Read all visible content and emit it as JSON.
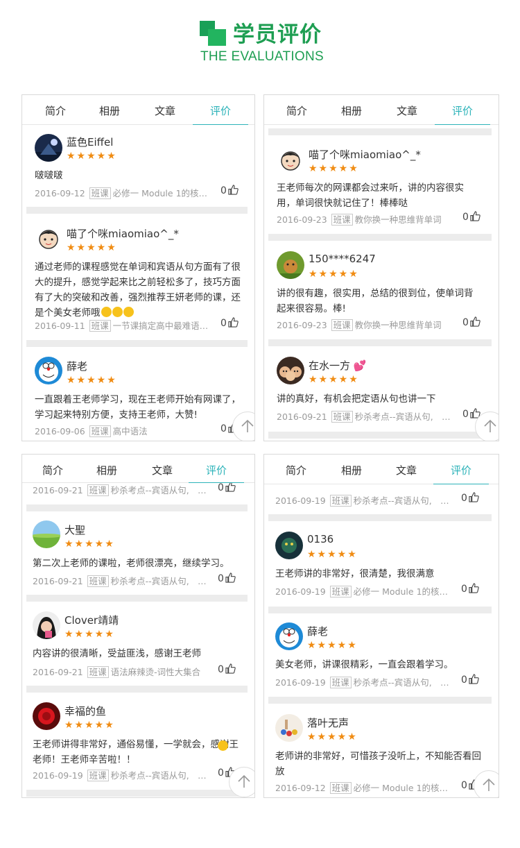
{
  "header": {
    "title": "学员评价",
    "subtitle": "THE EVALUATIONS"
  },
  "tabs": [
    "简介",
    "相册",
    "文章",
    "评价"
  ],
  "panels": [
    {
      "reviews": [
        {
          "name": "蓝色Eiffel",
          "text": "啵啵啵",
          "date": "2016-09-12",
          "course": "必修一 Module 1的核…",
          "likes": "0"
        },
        {
          "name": "喵了个咪miaomiao^_*",
          "text": "通过老师的课程感觉在单词和宾语从句方面有了很大的提升，感觉学起来比之前轻松多了，技巧方面有了大的突破和改善，强烈推荐王妍老师的课，还是个美女老师哦",
          "date": "2016-09-11",
          "course": "一节课搞定高中最难语…",
          "likes": "0"
        },
        {
          "name": "薛老",
          "text": "一直跟着王老师学习，现在王老师开始有网课了，学习起来特别方便，支持王老师，大赞!",
          "date": "2016-09-06",
          "course": "高中语法",
          "likes": "0"
        }
      ]
    },
    {
      "reviews": [
        {
          "name": "喵了个咪miaomiao^_*",
          "text": "王老师每次的网课都会过来听，讲的内容很实用，单词很快就记住了！棒棒哒",
          "date": "2016-09-23",
          "course": "教你换一种思维背单词",
          "likes": "0"
        },
        {
          "name": "150****6247",
          "text": "讲的很有趣，很实用，总结的很到位，使单词背起来很容易。棒!",
          "date": "2016-09-23",
          "course": "教你换一种思维背单词",
          "likes": "0"
        },
        {
          "name": "在水一方",
          "text": "讲的真好，有机会把定语从句也讲一下",
          "date": "2016-09-21",
          "course": "秒杀考点--宾语从句,　…",
          "likes": "0"
        }
      ]
    },
    {
      "reviews": [
        {
          "name": "",
          "text": "",
          "date": "2016-09-21",
          "course": "秒杀考点--宾语从句,　…",
          "likes": "0"
        },
        {
          "name": "大聖",
          "text": "第二次上老师的课啦，老师很漂亮，继续学习。",
          "date": "2016-09-21",
          "course": "秒杀考点--宾语从句,　…",
          "likes": "0"
        },
        {
          "name": "Clover靖靖",
          "text": "内容讲的很清晰，受益匪浅，感谢王老师",
          "date": "2016-09-21",
          "course": "语法麻辣烫-词性大集合",
          "likes": "0"
        },
        {
          "name": "幸福的鱼",
          "text": "王老师讲得非常好，通俗易懂，一学就会，感谢王老师！王老师辛苦啦！！",
          "date": "2016-09-19",
          "course": "秒杀考点--宾语从句,　…",
          "likes": "0"
        }
      ]
    },
    {
      "reviews": [
        {
          "name": "",
          "text": "",
          "date": "2016-09-19",
          "course": "秒杀考点--宾语从句,　…",
          "likes": "0"
        },
        {
          "name": "0136",
          "text": "王老师讲的非常好，很清楚，我很满意",
          "date": "2016-09-19",
          "course": "必修一 Module 1的核…",
          "likes": "0"
        },
        {
          "name": "薛老",
          "text": "美女老师，讲课很精彩，一直会跟着学习。",
          "date": "2016-09-19",
          "course": "秒杀考点--宾语从句,　…",
          "likes": "0"
        },
        {
          "name": "落叶无声",
          "text": "老师讲的非常好，可惜孩子没听上，不知能否看回放",
          "date": "2016-09-12",
          "course": "必修一 Module 1的核…",
          "likes": "0"
        }
      ]
    }
  ],
  "stars": "★★★★★",
  "course_tag": "班课",
  "colors": {
    "brand_green": "#1e9e52",
    "tab_active": "#2cb3b9",
    "star": "#f08c13"
  }
}
